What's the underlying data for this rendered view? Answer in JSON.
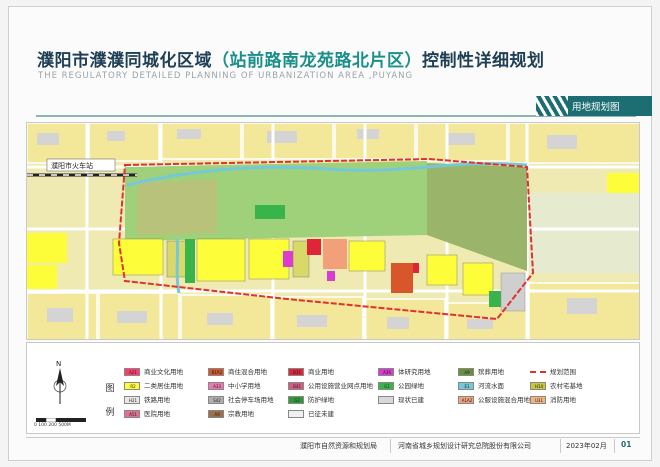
{
  "header": {
    "title_a": "濮阳市濮濮同城化区域",
    "title_b": "（站前路南龙苑路北片区）",
    "title_c": "控制性详细规划",
    "title_en": "THE REGULATORY DETAILED PLANNING OF URBANIZATION AREA ,PUYANG",
    "section_label": "用地规划图"
  },
  "map": {
    "station_label": "濮阳市火车站",
    "colors": {
      "background": "#f0ecb6",
      "residential": "#fdfd3a",
      "commercial": "#e8403a",
      "green": "#88c459",
      "park": "#9fd07a",
      "boundary": "#e03030",
      "road": "#ffffff",
      "water": "#74c8d9",
      "existing_grey": "#c9c9c9"
    }
  },
  "legend": {
    "head_1": "图",
    "head_2": "例",
    "north": "N",
    "scale_labels": "0    100    200        500M",
    "items": [
      {
        "label": "商业文化用地",
        "color": "#ff3a6e",
        "code": "A21"
      },
      {
        "label": "商住混合用地",
        "color": "#d9552a",
        "code": "B1R2"
      },
      {
        "label": "商业用地",
        "color": "#e0243a",
        "code": "B11"
      },
      {
        "label": "体研究用地",
        "color": "#dc3bd2",
        "code": "A36"
      },
      {
        "label": "殡葬用地",
        "color": "#6b8e3a",
        "code": "A9"
      },
      {
        "label": "规划范围",
        "color": "#e03030",
        "code": ""
      },
      {
        "label": "二类居住用地",
        "color": "#fdfd3a",
        "code": "R2"
      },
      {
        "label": "中小学用地",
        "color": "#ec7aae",
        "code": "A33"
      },
      {
        "label": "公用设施营业网点用地",
        "color": "#d35b84",
        "code": "B41"
      },
      {
        "label": "公园绿地",
        "color": "#39b44a",
        "code": "G1"
      },
      {
        "label": "河流水面",
        "color": "#74c8d9",
        "code": "E1"
      },
      {
        "label": "农村宅基地",
        "color": "#c6c73a",
        "code": "H14"
      },
      {
        "label": "铁路用地",
        "color": "#e8e8e8",
        "code": "H21"
      },
      {
        "label": "社会停车场用地",
        "color": "#b0b0b0",
        "code": "S42"
      },
      {
        "label": "防护绿地",
        "color": "#2f9a3a",
        "code": "G2"
      },
      {
        "label": "现状已建",
        "color": "#d8d8d8",
        "code": ""
      },
      {
        "label": "公服设施混合用地",
        "color": "#f2a07a",
        "code": "A1A2"
      },
      {
        "label": "消防用地",
        "color": "#f4b37a",
        "code": "U31"
      },
      {
        "label": "医院用地",
        "color": "#e56f8c",
        "code": "A51"
      },
      {
        "label": "宗教用地",
        "color": "#9c6f48",
        "code": "A9"
      },
      {
        "label": "已征未建",
        "color": "#f0f0f0",
        "code": ""
      }
    ]
  },
  "footer": {
    "org_1": "濮阳市自然资源和规划局",
    "org_2": "河南省城乡规划设计研究总院股份有限公司",
    "date": "2023年02月",
    "page": "01"
  }
}
